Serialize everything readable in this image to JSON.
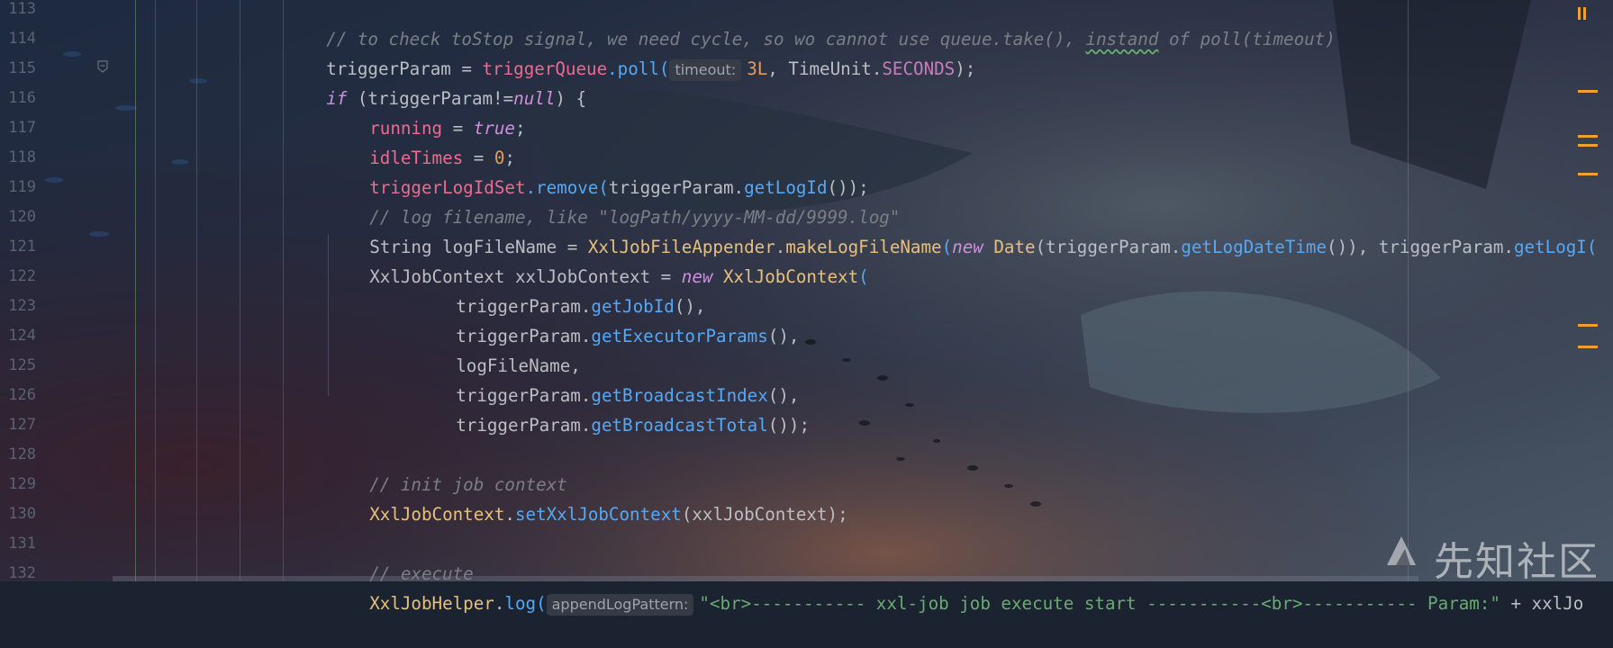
{
  "editor": {
    "line_numbers": [
      "113",
      "114",
      "115",
      "116",
      "117",
      "118",
      "119",
      "120",
      "121",
      "122",
      "123",
      "124",
      "125",
      "126",
      "127",
      "128",
      "129",
      "130",
      "131",
      "132"
    ],
    "inlay_hints": {
      "timeout": "timeout:",
      "appendLogPattern": "appendLogPattern:"
    },
    "code": {
      "l113": "// to check toStop signal, we need cycle, so wo cannot use queue.take(), ",
      "l113b": "instand",
      "l113c": " of poll(timeout)",
      "l114a": "triggerParam = ",
      "l114b": "triggerQueue",
      "l114c": ".poll(",
      "l114d": "3L",
      "l114e": ", TimeUnit.",
      "l114f": "SECONDS",
      "l114g": ");",
      "l115a": "if",
      "l115b": " (triggerParam!=",
      "l115c": "null",
      "l115d": ") {",
      "l116a": "running",
      "l116b": " = ",
      "l116c": "true",
      "l116d": ";",
      "l117a": "idleTimes",
      "l117b": " = ",
      "l117c": "0",
      "l117d": ";",
      "l118a": "triggerLogIdSet",
      "l118b": ".remove(",
      "l118c": "triggerParam.",
      "l118d": "getLogId",
      "l118e": "());",
      "l119": "// log filename, like \"logPath/yyyy-MM-dd/9999.log\"",
      "l120a": "String logFileName = ",
      "l120b": "XxlJobFileAppender",
      "l120c": ".",
      "l120d": "makeLogFileName",
      "l120e": "(",
      "l120f": "new",
      "l120g": " Date",
      "l120h": "(triggerParam.",
      "l120i": "getLogDateTime",
      "l120j": "()), triggerParam.",
      "l120k": "getLogI(",
      "l121a": "XxlJobContext xxlJobContext = ",
      "l121b": "new",
      "l121c": " XxlJobContext",
      "l121d": "(",
      "l122a": "triggerParam.",
      "l122b": "getJobId",
      "l122c": "(),",
      "l123a": "triggerParam.",
      "l123b": "getExecutorParams",
      "l123c": "(),",
      "l124": "logFileName,",
      "l125a": "triggerParam.",
      "l125b": "getBroadcastIndex",
      "l125c": "(),",
      "l126a": "triggerParam.",
      "l126b": "getBroadcastTotal",
      "l126c": "());",
      "l128": "// init job context",
      "l129a": "XxlJobContext",
      "l129b": ".",
      "l129c": "setXxlJobContext",
      "l129d": "(xxlJobContext);",
      "l131": "// execute",
      "l132a": "XxlJobHelper",
      "l132b": ".",
      "l132c": "log",
      "l132d": "(",
      "l132e": "\"<br>----------- xxl-job job execute start -----------<br>----------- Param:\"",
      "l132f": " + xxlJo"
    }
  },
  "watermark": {
    "text": "先知社区"
  },
  "colors": {
    "keyword": "#cf8ee0",
    "function": "#56a8f5",
    "field": "#ec6b8f",
    "class": "#e8c07d",
    "number": "#e99a57",
    "string": "#6aab73",
    "comment": "#7a7e85",
    "marker": "#f0a030"
  }
}
